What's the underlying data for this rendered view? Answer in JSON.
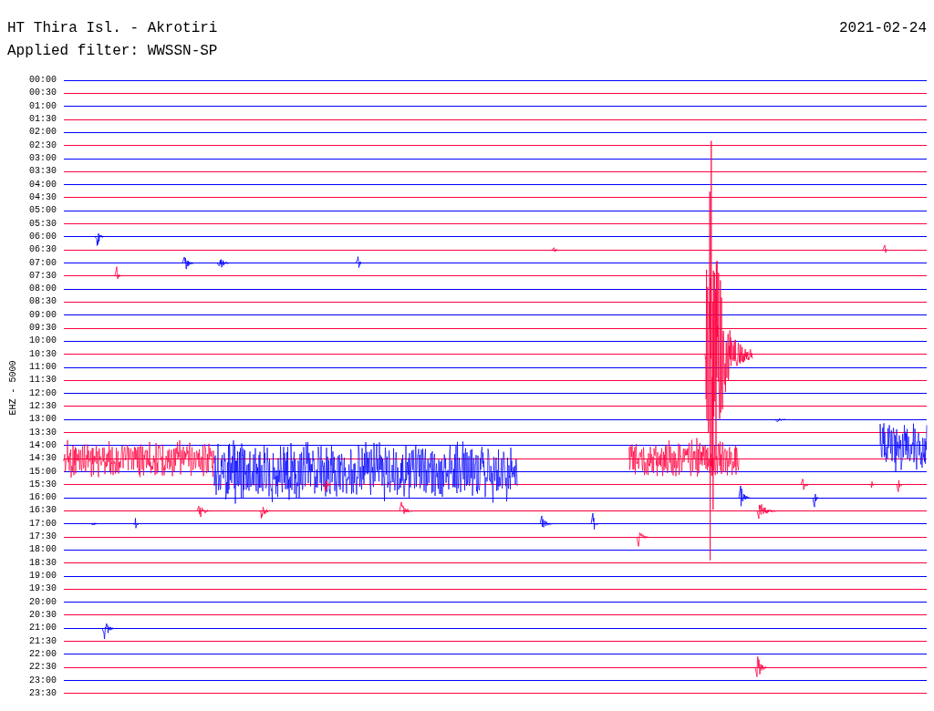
{
  "title": "HT Thira Isl. - Akrotiri",
  "date": "2021-02-24",
  "filter": "Applied filter: WWSSN-SP",
  "channel_label": "EHZ - 5000",
  "rows": [
    {
      "time": "00:00",
      "color": "#0000ff"
    },
    {
      "time": "00:30",
      "color": "#ff0040"
    },
    {
      "time": "01:00",
      "color": "#0000ff"
    },
    {
      "time": "01:30",
      "color": "#ff0040"
    },
    {
      "time": "02:00",
      "color": "#0000ff"
    },
    {
      "time": "02:30",
      "color": "#ff0040"
    },
    {
      "time": "03:00",
      "color": "#0000ff"
    },
    {
      "time": "03:30",
      "color": "#ff0040"
    },
    {
      "time": "04:00",
      "color": "#0000ff"
    },
    {
      "time": "04:30",
      "color": "#ff0040"
    },
    {
      "time": "05:00",
      "color": "#0000ff"
    },
    {
      "time": "05:30",
      "color": "#ff0040"
    },
    {
      "time": "06:00",
      "color": "#0000ff"
    },
    {
      "time": "06:30",
      "color": "#ff0040"
    },
    {
      "time": "07:00",
      "color": "#0000ff"
    },
    {
      "time": "07:30",
      "color": "#ff0040"
    },
    {
      "time": "08:00",
      "color": "#0000ff"
    },
    {
      "time": "08:30",
      "color": "#ff0040"
    },
    {
      "time": "09:00",
      "color": "#0000ff"
    },
    {
      "time": "09:30",
      "color": "#ff0040"
    },
    {
      "time": "10:00",
      "color": "#0000ff"
    },
    {
      "time": "10:30",
      "color": "#ff0040"
    },
    {
      "time": "11:00",
      "color": "#0000ff"
    },
    {
      "time": "11:30",
      "color": "#ff0040"
    },
    {
      "time": "12:00",
      "color": "#0000ff"
    },
    {
      "time": "12:30",
      "color": "#ff0040"
    },
    {
      "time": "13:00",
      "color": "#0000ff"
    },
    {
      "time": "13:30",
      "color": "#ff0040"
    },
    {
      "time": "14:00",
      "color": "#0000ff"
    },
    {
      "time": "14:30",
      "color": "#ff0040"
    },
    {
      "time": "15:00",
      "color": "#0000ff"
    },
    {
      "time": "15:30",
      "color": "#ff0040"
    },
    {
      "time": "16:00",
      "color": "#0000ff"
    },
    {
      "time": "16:30",
      "color": "#ff0040"
    },
    {
      "time": "17:00",
      "color": "#0000ff"
    },
    {
      "time": "17:30",
      "color": "#ff0040"
    },
    {
      "time": "18:00",
      "color": "#0000ff"
    },
    {
      "time": "18:30",
      "color": "#ff0040"
    },
    {
      "time": "19:00",
      "color": "#0000ff"
    },
    {
      "time": "19:30",
      "color": "#ff0040"
    },
    {
      "time": "20:00",
      "color": "#0000ff"
    },
    {
      "time": "20:30",
      "color": "#ff0040"
    },
    {
      "time": "21:00",
      "color": "#0000ff"
    },
    {
      "time": "21:30",
      "color": "#ff0040"
    },
    {
      "time": "22:00",
      "color": "#0000ff"
    },
    {
      "time": "22:30",
      "color": "#ff0040"
    },
    {
      "time": "23:00",
      "color": "#0000ff"
    },
    {
      "time": "23:30",
      "color": "#ff0040"
    }
  ]
}
